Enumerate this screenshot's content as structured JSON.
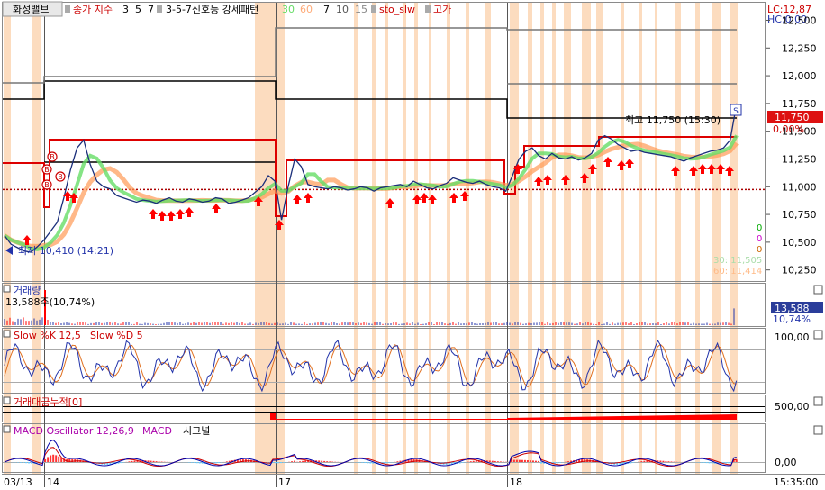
{
  "header": {
    "title": "화성밸브",
    "indicator_label": "종가 지수",
    "indicator_params": [
      "3",
      "5",
      "7"
    ],
    "pattern_label": "3-5-7신호등 강세패턴",
    "ma_params": [
      "30",
      "60"
    ],
    "sto_params": [
      "7",
      "10",
      "15"
    ],
    "sto_name": "sto_slw",
    "high_label": "고가"
  },
  "corner": {
    "lc": "LC:12,87",
    "hc": "HC:0,00"
  },
  "price_panel": {
    "y_ticks": [
      "12,500",
      "12,250",
      "12,000",
      "11,750",
      "11,500",
      "11,250",
      "11,000",
      "10,750",
      "10,500",
      "10,250"
    ],
    "current_price": "11,750",
    "change": "0,00%",
    "high_annotation": "최고 11,750 (15:30)",
    "low_annotation": "최저 10,410 (14:21)",
    "signal_values": [
      "0",
      "0",
      "0"
    ],
    "ma30_label": "30: 11,505",
    "ma60_label": "60: 11,414"
  },
  "volume_panel": {
    "title": "거래량",
    "value": "13,588주(10,74%)",
    "badge_value": "13,588",
    "badge_pct": "10,74%"
  },
  "stoch_panel": {
    "title_k": "Slow %K 12,5",
    "title_d": "Slow %D 5",
    "y_tick": "100,00"
  },
  "cum_panel": {
    "title": "거래대금누적[0]",
    "y_tick": "500,00"
  },
  "macd_panel": {
    "title_osc": "MACD Oscillator 12,26,9",
    "title_macd": "MACD",
    "title_signal": "시그널",
    "y_tick": "0,00"
  },
  "x_axis": {
    "labels": [
      "03/13",
      "14",
      "17",
      "18"
    ],
    "time": "15:35:00"
  },
  "colors": {
    "up": "#ff0000",
    "ma30": "#66dd66",
    "ma60": "#ff9a55",
    "macd": "#0000aa",
    "signal": "#cc0000",
    "shade": "#fcdcbf",
    "axis_text": "#000000"
  },
  "chart_data": {
    "type": "line",
    "title": "화성밸브",
    "ylim": [
      10150,
      12650
    ],
    "ref_levels": {
      "dotted": 10975,
      "black_upper": 11790,
      "black_mid": 11300,
      "gray_top": 12610,
      "gray_mid": 12080
    },
    "current": 11750,
    "high": {
      "value": 11750,
      "time": "15:30"
    },
    "low": {
      "value": 10410,
      "time": "14:21"
    },
    "sessions": [
      {
        "label": "03/13",
        "close_range": [
          10410,
          10650
        ]
      },
      {
        "label": "14",
        "close_range": [
          10800,
          11500
        ]
      },
      {
        "label": "17",
        "close_range": [
          10680,
          11300
        ]
      },
      {
        "label": "18",
        "close_range": [
          10950,
          11750
        ]
      }
    ],
    "price_series": [
      10560,
      10480,
      10450,
      10420,
      10410,
      10460,
      10520,
      10600,
      10680,
      10900,
      11150,
      11350,
      11420,
      11200,
      11050,
      11000,
      10980,
      10920,
      10900,
      10880,
      10860,
      10880,
      10870,
      10850,
      10880,
      10900,
      10870,
      10860,
      10890,
      10880,
      10860,
      10870,
      10900,
      10890,
      10850,
      10860,
      10880,
      10900,
      10950,
      11000,
      11100,
      11050,
      10700,
      11000,
      11250,
      11180,
      11020,
      11000,
      10990,
      10980,
      11000,
      10990,
      10970,
      10980,
      11000,
      10990,
      10960,
      10990,
      11000,
      11010,
      11020,
      11000,
      11050,
      11020,
      10990,
      10980,
      11010,
      11030,
      11080,
      11060,
      11040,
      11030,
      11050,
      11020,
      11000,
      10990,
      10960,
      11100,
      11250,
      11320,
      11350,
      11280,
      11250,
      11300,
      11260,
      11250,
      11270,
      11240,
      11260,
      11300,
      11420,
      11460,
      11430,
      11380,
      11350,
      11320,
      11330,
      11310,
      11300,
      11290,
      11280,
      11270,
      11250,
      11230,
      11260,
      11280,
      11300,
      11320,
      11330,
      11350,
      11420,
      11750
    ],
    "stoch_range": [
      0,
      100
    ],
    "volume_last": 13588
  }
}
